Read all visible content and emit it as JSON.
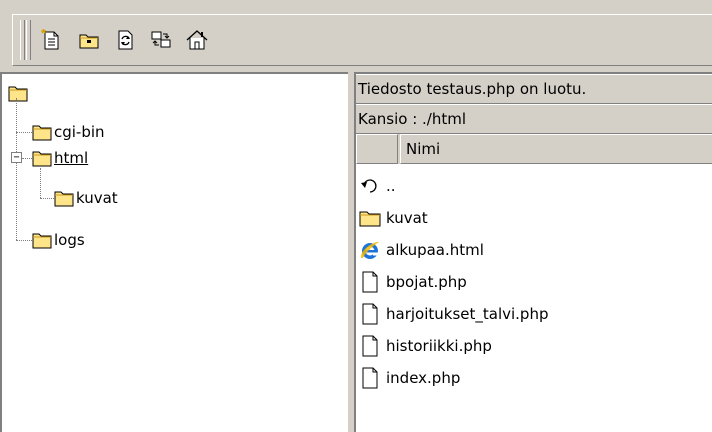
{
  "toolbar": {
    "buttons": [
      {
        "name": "new-file-icon"
      },
      {
        "name": "new-folder-icon"
      },
      {
        "name": "refresh-icon"
      },
      {
        "name": "copy-icon"
      },
      {
        "name": "home-icon"
      }
    ]
  },
  "tree": {
    "root_label": "",
    "items": [
      {
        "label": "cgi-bin"
      },
      {
        "label": "html"
      },
      {
        "label": "kuvat"
      },
      {
        "label": "logs"
      }
    ],
    "expander_symbol": "−"
  },
  "right": {
    "status": "Tiedosto testaus.php on luotu.",
    "folder_path": "Kansio : ./html",
    "column_name": "Nimi",
    "files": [
      {
        "name": "..",
        "icon": "up-arrow-icon"
      },
      {
        "name": "kuvat",
        "icon": "folder-icon"
      },
      {
        "name": "alkupaa.html",
        "icon": "internet-explorer-icon"
      },
      {
        "name": "bpojat.php",
        "icon": "document-icon"
      },
      {
        "name": "harjoitukset_talvi.php",
        "icon": "document-icon"
      },
      {
        "name": "historiikki.php",
        "icon": "document-icon"
      },
      {
        "name": "index.php",
        "icon": "document-icon"
      }
    ]
  },
  "colors": {
    "chrome": "#d4d0c8",
    "folder": "#ffe58a",
    "folder_dark": "#c89a1e"
  }
}
